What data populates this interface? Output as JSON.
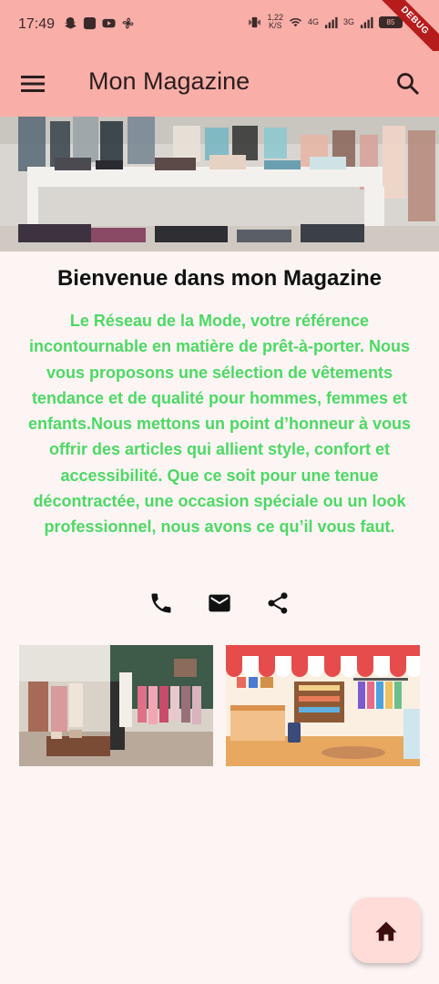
{
  "status_bar": {
    "time": "17:49",
    "net_speed_value": "1,22",
    "net_speed_unit": "K/S",
    "signal_1": "4G",
    "signal_2": "3G",
    "battery": "85"
  },
  "debug_banner": "DEBUG",
  "app_bar": {
    "title": "Mon Magazine",
    "menu_icon": "menu-icon",
    "search_icon": "search-icon"
  },
  "main": {
    "welcome_title": "Bienvenue dans mon Magazine",
    "description": "Le Réseau de la Mode, votre référence incontournable en matière de prêt-à-porter. Nous vous proposons une sélection de vêtements tendance et de qualité pour hommes, femmes et enfants.Nous mettons un point d’honneur à vous offrir des articles qui allient style, confort et accessibilité. Que ce soit pour une tenue décontractée, une occasion spéciale ou un look professionnel, nous avons ce qu’il vous faut.",
    "contact_icons": [
      "phone-icon",
      "email-icon",
      "share-icon"
    ]
  },
  "fab": {
    "icon": "home-icon"
  },
  "colors": {
    "app_bar": "#f9aea8",
    "background": "#fdf5f4",
    "description_text": "#4cd964",
    "fab": "#ffdcd8",
    "fab_icon": "#3b0d0d"
  }
}
